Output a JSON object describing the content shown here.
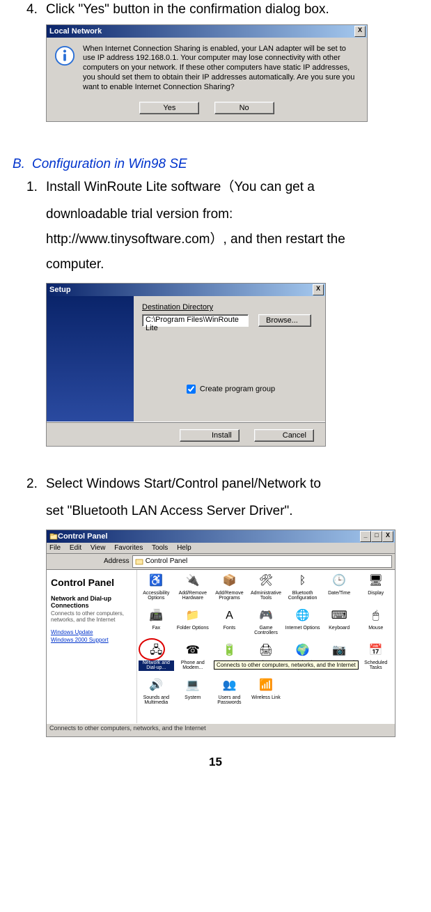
{
  "step4": {
    "num": "4.",
    "text": "Click \"Yes\" button in the confirmation dialog box."
  },
  "dlg1": {
    "title": "Local Network",
    "close_x": "X",
    "message": "When Internet Connection Sharing is enabled, your LAN adapter will be set to use IP address 192.168.0.1. Your computer may lose connectivity with other computers on your network. If these other computers have static IP addresses, you should set them to obtain their IP addresses automatically. Are you sure you want to enable Internet Connection Sharing?",
    "yes": "Yes",
    "no": "No"
  },
  "sectionB": {
    "num": "B.",
    "title": "Configuration in Win98 SE"
  },
  "stepB1": {
    "num": "1.",
    "line1": "Install WinRoute Lite software（You can get a",
    "line2": "downloadable trial version from:",
    "line3": "http://www.tinysoftware.com）, and then restart the",
    "line4": "computer."
  },
  "dlg2": {
    "title": "Setup",
    "close_x": "X",
    "dest_label": "Destination Directory",
    "path": "C:\\Program Files\\WinRoute Lite",
    "browse": "Browse...",
    "checkbox_label": "Create program group",
    "install": "Install",
    "cancel": "Cancel"
  },
  "stepB2": {
    "num": "2.",
    "line1": "Select Windows Start/Control panel/Network to",
    "line2": "set \"Bluetooth LAN Access Server Driver\"."
  },
  "dlg3": {
    "title": "Control Panel",
    "close_x": "X",
    "menu": {
      "file": "File",
      "edit": "Edit",
      "view": "View",
      "favorites": "Favorites",
      "tools": "Tools",
      "help": "Help"
    },
    "addr_label": "Address",
    "addr_value": "Control Panel",
    "side": {
      "title": "Control Panel",
      "sub": "Network and Dial-up Connections",
      "desc": "Connects to other computers, networks, and the Internet",
      "link1": "Windows Update",
      "link2": "Windows 2000 Support"
    },
    "items": [
      {
        "label": "Accessibility Options",
        "glyph": "♿"
      },
      {
        "label": "Add/Remove Hardware",
        "glyph": "🔌"
      },
      {
        "label": "Add/Remove Programs",
        "glyph": "📦"
      },
      {
        "label": "Administrative Tools",
        "glyph": "🛠"
      },
      {
        "label": "Bluetooth Configuration",
        "glyph": "ᛒ"
      },
      {
        "label": "Date/Time",
        "glyph": "🕒"
      },
      {
        "label": "Display",
        "glyph": "🖥"
      },
      {
        "label": "Fax",
        "glyph": "📠"
      },
      {
        "label": "Folder Options",
        "glyph": "📁"
      },
      {
        "label": "Fonts",
        "glyph": "A"
      },
      {
        "label": "Game Controllers",
        "glyph": "🎮"
      },
      {
        "label": "Internet Options",
        "glyph": "🌐"
      },
      {
        "label": "Keyboard",
        "glyph": "⌨"
      },
      {
        "label": "Mouse",
        "glyph": "🖱"
      },
      {
        "label": "Network and Dial-up...",
        "glyph": "🖧",
        "selected": true
      },
      {
        "label": "Phone and Modem...",
        "glyph": "☎"
      },
      {
        "label": "Power Options",
        "glyph": "🔋"
      },
      {
        "label": "Printers",
        "glyph": "🖨"
      },
      {
        "label": "Regional Options",
        "glyph": "🌍"
      },
      {
        "label": "Scanners and Cameras",
        "glyph": "📷"
      },
      {
        "label": "Scheduled Tasks",
        "glyph": "📅"
      },
      {
        "label": "Sounds and Multimedia",
        "glyph": "🔊"
      },
      {
        "label": "System",
        "glyph": "💻"
      },
      {
        "label": "Users and Passwords",
        "glyph": "👥"
      },
      {
        "label": "Wireless Link",
        "glyph": "📶"
      }
    ],
    "tooltip": "Connects to other computers, networks, and the Internet",
    "status": "Connects to other computers, networks, and the Internet"
  },
  "page_number": "15"
}
